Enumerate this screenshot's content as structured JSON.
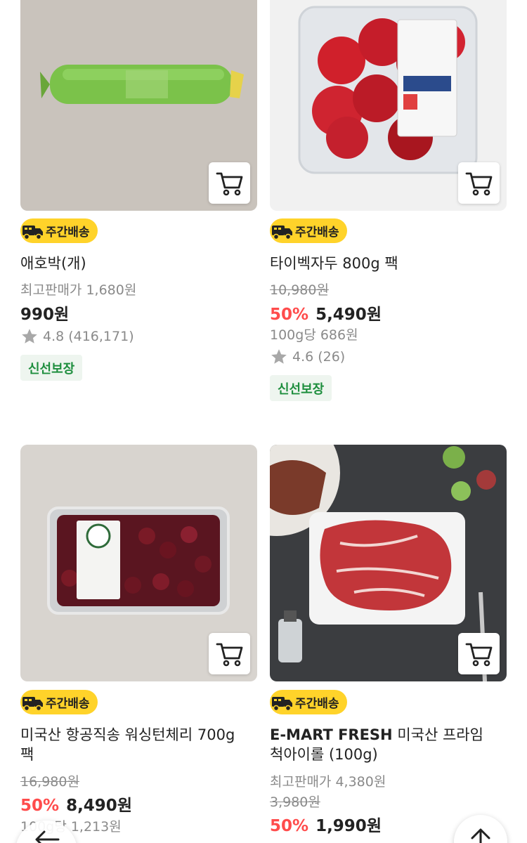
{
  "products": [
    {
      "name": "애호박(개)",
      "badge": "주간배송",
      "reference_price": "최고판매가 1,680원",
      "price": "990원",
      "rating": "4.8",
      "review_count": "(416,171)",
      "tag": "신선보장"
    },
    {
      "name": "타이벡자두 800g 팩",
      "badge": "주간배송",
      "original_price": "10,980원",
      "discount": "50%",
      "price": "5,490원",
      "unit_price": "100g당 686원",
      "rating": "4.6",
      "review_count": "(26)",
      "tag": "신선보장"
    },
    {
      "name_line1": "미국산 항공직송 워싱턴체리 700g",
      "name_line2": "팩",
      "badge": "주간배송",
      "original_price": "16,980원",
      "discount": "50%",
      "price": "8,490원",
      "unit_price": "100g당 1,213원"
    },
    {
      "brand": "E-MART FRESH",
      "name_line1": " 미국산 프라임",
      "name_line2": "척아이롤 (100g)",
      "badge": "주간배송",
      "reference_price": "최고판매가 4,380원",
      "original_price": "3,980원",
      "discount": "50%",
      "price": "1,990원"
    }
  ],
  "icons": {
    "cart": "cart-icon",
    "star": "star-icon",
    "truck": "delivery-truck-icon",
    "back": "arrow-left-icon",
    "top": "arrow-up-icon"
  },
  "colors": {
    "discount": "#ff4c4c",
    "badge": "#ffd32a",
    "fresh_text": "#1e8e3e",
    "muted": "#8a8a8a"
  }
}
